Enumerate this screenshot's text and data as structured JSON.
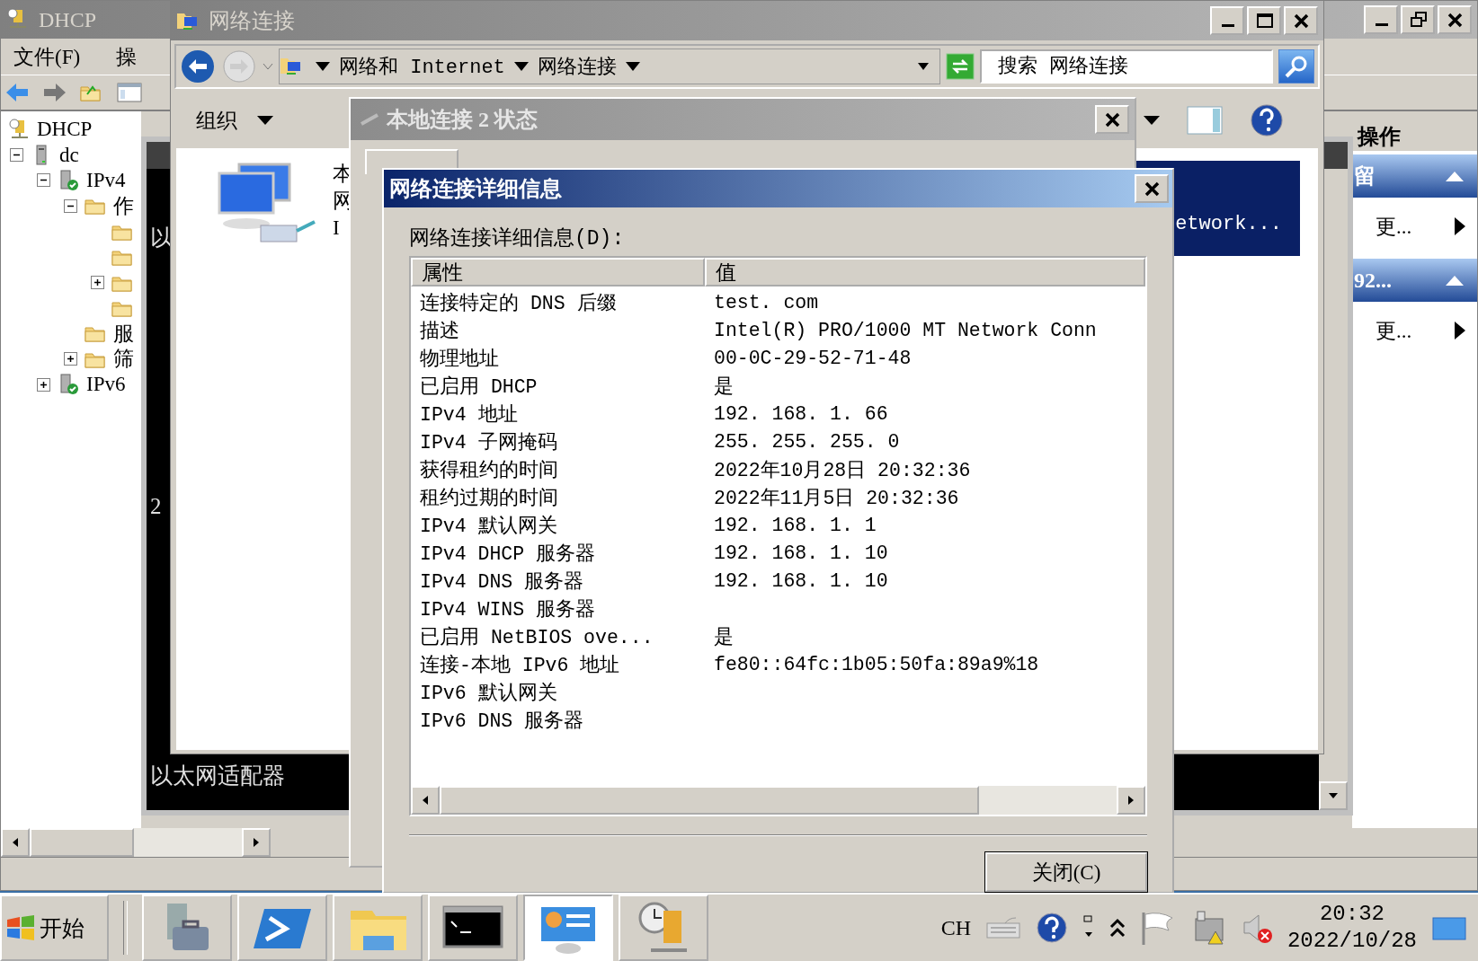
{
  "dhcp_window": {
    "title": "DHCP",
    "menu": [
      "文件(F)",
      "操"
    ],
    "tree": [
      {
        "label": "DHCP",
        "kind": "dhcp",
        "children": [
          {
            "label": "dc",
            "kind": "server",
            "expanded": true,
            "children": [
              {
                "label": "IPv4",
                "kind": "protocol",
                "expanded": true,
                "children": [
                  {
                    "label": "作",
                    "kind": "folder",
                    "expanded": true,
                    "children": [
                      {
                        "kind": "folder"
                      },
                      {
                        "kind": "folder"
                      },
                      {
                        "kind": "folder",
                        "expanded": false
                      },
                      {
                        "kind": "folder"
                      }
                    ]
                  },
                  {
                    "label": "服",
                    "kind": "folder"
                  },
                  {
                    "label": "筛",
                    "kind": "folder",
                    "expanded": false
                  }
                ]
              },
              {
                "label": "IPv6",
                "kind": "protocol",
                "expanded": false
              }
            ]
          }
        ]
      }
    ],
    "actions": {
      "title": "操作",
      "sections": [
        {
          "title": "留",
          "items": [
            "更..."
          ]
        },
        {
          "title": "92...",
          "items": [
            "更..."
          ]
        }
      ]
    }
  },
  "console_window": {
    "lines": [
      "以",
      "2",
      "以太网适配器"
    ]
  },
  "network_window": {
    "title": "网络连接",
    "breadcrumb": [
      "网络和 Internet",
      "网络连接"
    ],
    "search": {
      "placeholder": "搜索 网络连接"
    },
    "toolbar": [
      "组织"
    ],
    "items": [
      {
        "lines": [
          "本",
          "网",
          "I"
        ],
        "selected": false
      },
      {
        "lines": [
          "etwork..."
        ],
        "selected": true
      }
    ]
  },
  "status_dialog": {
    "title": "本地连接 2 状态"
  },
  "details_dialog": {
    "title": "网络连接详细信息",
    "label": "网络连接详细信息(D):",
    "columns": [
      "属性",
      "值"
    ],
    "rows": [
      [
        "连接特定的 DNS 后缀",
        "test. com"
      ],
      [
        "描述",
        "Intel(R) PRO/1000 MT Network Conn"
      ],
      [
        "物理地址",
        "00-0C-29-52-71-48"
      ],
      [
        "已启用 DHCP",
        "是"
      ],
      [
        "IPv4 地址",
        "192. 168. 1. 66"
      ],
      [
        "IPv4 子网掩码",
        "255. 255. 255. 0"
      ],
      [
        "获得租约的时间",
        "2022年10月28日 20:32:36"
      ],
      [
        "租约过期的时间",
        "2022年11月5日 20:32:36"
      ],
      [
        "IPv4 默认网关",
        "192. 168. 1. 1"
      ],
      [
        "IPv4 DHCP 服务器",
        "192. 168. 1. 10"
      ],
      [
        "IPv4 DNS 服务器",
        "192. 168. 1. 10"
      ],
      [
        "IPv4 WINS 服务器",
        null
      ],
      [
        "已启用 NetBIOS ove...",
        "是"
      ],
      [
        "连接-本地 IPv6 地址",
        "fe80::64fc:1b05:50fa:89a9%18"
      ],
      [
        "IPv6 默认网关",
        null
      ],
      [
        "IPv6 DNS 服务器",
        null
      ]
    ],
    "button": "关闭(C)"
  },
  "taskbar": {
    "start": "开始",
    "apps": [
      {
        "kind": "server-manager",
        "selected": false
      },
      {
        "kind": "powershell",
        "selected": false
      },
      {
        "kind": "explorer",
        "selected": false
      },
      {
        "kind": "command-prompt",
        "selected": false
      },
      {
        "kind": "control-panel",
        "selected": true
      },
      {
        "kind": "dhcp",
        "selected": false
      }
    ],
    "language": "CH",
    "time": "20:32",
    "date": "2022/10/28"
  }
}
